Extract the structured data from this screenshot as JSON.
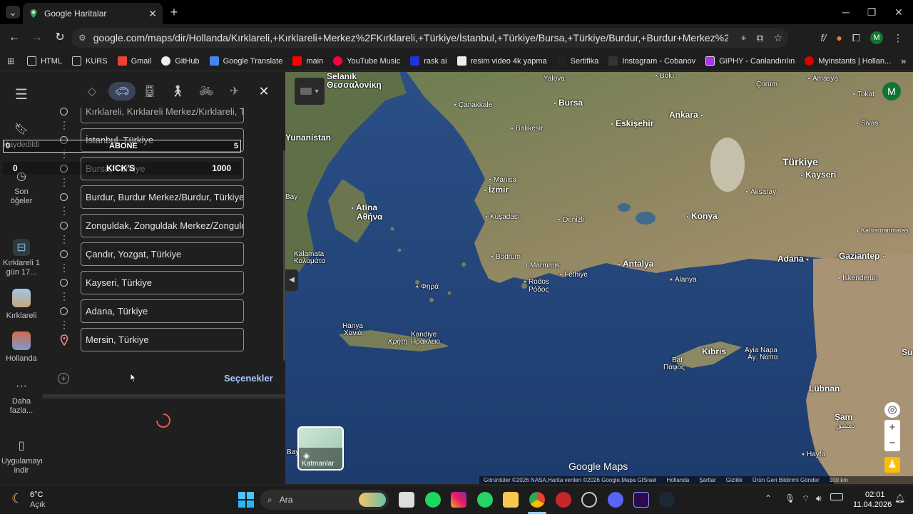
{
  "browser": {
    "tab_title": "Google Haritalar",
    "url": "google.com/maps/dir/Hollanda/Kırklareli,+Kırklareli+Merkez%2FKırklareli,+Türkiye/İstanbul,+Türkiye/Bursa,+Türkiye/Burdur,+Burdur+Merkez%2FBurdur,+Türkiye/Zonguldak,+Zonguldak+Merkez...",
    "profile_initial": "M",
    "bookmarks": [
      "HTML",
      "KURS",
      "Gmail",
      "GitHub",
      "Google Translate",
      "main",
      "YouTube Music",
      "rask ai",
      "resim video 4k yapma",
      "Sertifika",
      "Instagram - Cobanov",
      "GIPHY - Canlandırılın",
      "Myinstants | Hollan..."
    ]
  },
  "rail": {
    "saved": "Kaydedildi",
    "recent": "Son öğeler",
    "trip": "Kırklareli 1 gün 17...",
    "place1": "Kırklareli",
    "place2": "Hollanda",
    "more": "Daha fazla...",
    "app": "Uygulamayı indir"
  },
  "directions": {
    "stops": [
      "Kırklareli, Kırklareli Merkez/Kırklareli, Türkiye",
      "İstanbul, Türkiye",
      "Bursa, Türkiye",
      "Burdur, Burdur Merkez/Burdur, Türkiye",
      "Zonguldak, Zonguldak Merkez/Zonguldak",
      "Çandır, Yozgat, Türkiye",
      "Kayseri, Türkiye",
      "Adana, Türkiye",
      "Mersin, Türkiye"
    ],
    "options": "Seçenekler"
  },
  "overlay": {
    "row1_left": "0",
    "row1_title": "ABONE",
    "row1_right": "5",
    "row2_left": "0",
    "row2_title": "KICK'S",
    "row2_right": "1000"
  },
  "map": {
    "places": {
      "selanik": "Selanik",
      "thessaloniki": "Θεσσαλονίκη",
      "yunanistan": "Yunanistan",
      "atina": "Atina",
      "athina": "Αθήνα",
      "kalamata": "Kalamata",
      "kalamata_gr": "Καλαμάτα",
      "hanya": "Hanya",
      "chania": "Χανιά",
      "kandiye": "Kandiye",
      "irakleio": "Ηράκλειο",
      "kriti": "Κρήτη",
      "fira": "Φηρά",
      "canakkale": "Çanakkale",
      "balikesir": "Balıkesir",
      "bursa": "Bursa",
      "yalova": "Yalova",
      "bolu": "Bolu",
      "corum": "Çorum",
      "amasya": "Amasya",
      "tokat": "Tokat",
      "sivas": "Sivas",
      "eskisehir": "Eskişehir",
      "ankara": "Ankara",
      "turkiye": "Türkiye",
      "kayseri": "Kayseri",
      "aksaray": "Aksaray",
      "konya": "Konya",
      "kahramanmaras": "Kahramanmaraş",
      "gaziantep": "Gaziantep",
      "adana": "Adana",
      "iskenderun": "İskenderun",
      "manisa": "Manisa",
      "izmir": "İzmir",
      "kusadasi": "Kuşadası",
      "denizli": "Denizli",
      "bodrum": "Bodrum",
      "marmaris": "Marmaris",
      "fethiye": "Fethiye",
      "antalya": "Antalya",
      "alanya": "Alanya",
      "rodos": "Rodos",
      "rodos_gr": "Ρόδος",
      "kibris": "Kıbrıs",
      "baf": "Baf",
      "pafos": "Πάφος",
      "ayianapa": "Ayia Napa",
      "ayianapa_gr": "Αγ. Νάπα",
      "lubnan": "Lübnan",
      "sam": "Şam",
      "sam_ar": "دمشق",
      "hayfa": "Hayfa",
      "bay": "Bay",
      "su": "Su"
    },
    "layers_label": "Katmanlar",
    "brand": "Google Maps",
    "footer": [
      "Görüntüler ©2026 NASA,Harita verileri ©2026 Google,Mapa GISrael",
      "Hollanda",
      "Şartlar",
      "Gizlilik",
      "Ürün Geri Bildirimi Gönder",
      "100 km"
    ]
  },
  "taskbar": {
    "temp": "6°C",
    "weather": "Açık",
    "search": "Ara",
    "time": "02:01",
    "date": "11.04.2026"
  }
}
